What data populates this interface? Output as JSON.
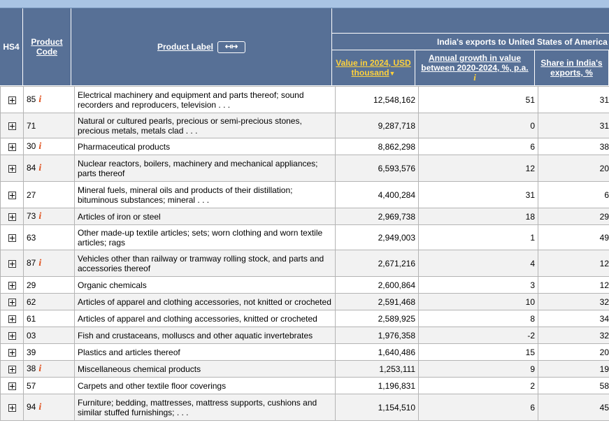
{
  "header": {
    "hs4": "HS4",
    "product_code": "Product Code",
    "product_label": "Product Label",
    "expand_icon": "↤↦",
    "group_title": "India's exports to United States of America",
    "value_col": "Value in 2024, USD thousand",
    "value_sort_icon": "▼",
    "growth_col": "Annual growth in value between 2020-2024, %, p.a.",
    "share_col": "Share in India's exports, %",
    "info_glyph": "i"
  },
  "rows": [
    {
      "code": "85",
      "info": true,
      "label": "Electrical machinery and equipment and parts thereof; sound recorders and reproducers, television . . .",
      "value": "12,548,162",
      "growth": "51",
      "share": "31"
    },
    {
      "code": "71",
      "info": false,
      "label": "Natural or cultured pearls, precious or semi-precious stones, precious metals, metals clad . . .",
      "value": "9,287,718",
      "growth": "0",
      "share": "31"
    },
    {
      "code": "30",
      "info": true,
      "label": "Pharmaceutical products",
      "value": "8,862,298",
      "growth": "6",
      "share": "38"
    },
    {
      "code": "84",
      "info": true,
      "label": "Nuclear reactors, boilers, machinery and mechanical appliances; parts thereof",
      "value": "6,593,576",
      "growth": "12",
      "share": "20"
    },
    {
      "code": "27",
      "info": false,
      "label": "Mineral fuels, mineral oils and products of their distillation; bituminous substances; mineral . . .",
      "value": "4,400,284",
      "growth": "31",
      "share": "6"
    },
    {
      "code": "73",
      "info": true,
      "label": "Articles of iron or steel",
      "value": "2,969,738",
      "growth": "18",
      "share": "29"
    },
    {
      "code": "63",
      "info": false,
      "label": "Other made-up textile articles; sets; worn clothing and worn textile articles; rags",
      "value": "2,949,003",
      "growth": "1",
      "share": "49"
    },
    {
      "code": "87",
      "info": true,
      "label": "Vehicles other than railway or tramway rolling stock, and parts and accessories thereof",
      "value": "2,671,216",
      "growth": "4",
      "share": "12"
    },
    {
      "code": "29",
      "info": false,
      "label": "Organic chemicals",
      "value": "2,600,864",
      "growth": "3",
      "share": "12"
    },
    {
      "code": "62",
      "info": false,
      "label": "Articles of apparel and clothing accessories, not knitted or crocheted",
      "value": "2,591,468",
      "growth": "10",
      "share": "32"
    },
    {
      "code": "61",
      "info": false,
      "label": "Articles of apparel and clothing accessories, knitted or crocheted",
      "value": "2,589,925",
      "growth": "8",
      "share": "34"
    },
    {
      "code": "03",
      "info": false,
      "label": "Fish and crustaceans, molluscs and other aquatic invertebrates",
      "value": "1,976,358",
      "growth": "-2",
      "share": "32"
    },
    {
      "code": "39",
      "info": false,
      "label": "Plastics and articles thereof",
      "value": "1,640,486",
      "growth": "15",
      "share": "20"
    },
    {
      "code": "38",
      "info": true,
      "label": "Miscellaneous chemical products",
      "value": "1,253,111",
      "growth": "9",
      "share": "19"
    },
    {
      "code": "57",
      "info": false,
      "label": "Carpets and other textile floor coverings",
      "value": "1,196,831",
      "growth": "2",
      "share": "58"
    },
    {
      "code": "94",
      "info": true,
      "label": "Furniture; bedding, mattresses, mattress supports, cushions and similar stuffed furnishings; . . .",
      "value": "1,154,510",
      "growth": "6",
      "share": "45"
    }
  ],
  "colors": {
    "header_bg": "#577096",
    "top_bar": "#a9c4e4",
    "sort_highlight": "#ffd23c",
    "info_icon": "#e0501c"
  }
}
